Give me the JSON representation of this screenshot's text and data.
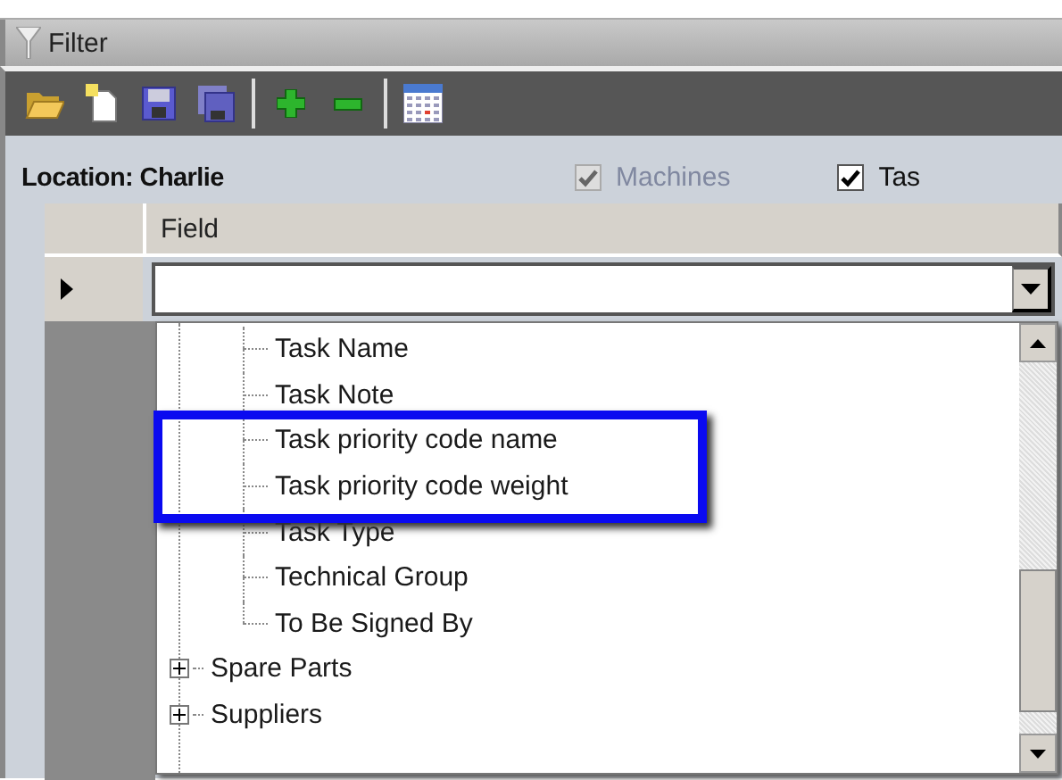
{
  "window": {
    "title": "Filter"
  },
  "toolbar": [
    {
      "kind": "open"
    },
    {
      "kind": "new"
    },
    {
      "kind": "save"
    },
    {
      "kind": "save-all"
    },
    {
      "kind": "separator"
    },
    {
      "kind": "add"
    },
    {
      "kind": "remove"
    },
    {
      "kind": "separator"
    },
    {
      "kind": "calendar"
    }
  ],
  "location": "Location: Charlie",
  "checkboxes": [
    {
      "label": "Machines",
      "checked": true,
      "disabled": true
    },
    {
      "label": "Tas",
      "checked": true,
      "disabled": false
    }
  ],
  "grid": {
    "columns": [
      "Field"
    ]
  },
  "tree": {
    "items": [
      {
        "children": [
          {
            "label": "Task Name",
            "highlighted": false
          },
          {
            "label": "Task Note",
            "highlighted": false
          },
          {
            "label": "Task priority code name",
            "highlighted": true
          },
          {
            "label": "Task priority code weight",
            "highlighted": true
          },
          {
            "label": "Task Type",
            "highlighted": false
          },
          {
            "label": "Technical Group",
            "highlighted": false
          },
          {
            "label": "To Be Signed By",
            "highlighted": false
          }
        ]
      },
      {
        "label": "Spare Parts",
        "expanded": false
      },
      {
        "label": "Suppliers",
        "expanded": false
      }
    ]
  }
}
